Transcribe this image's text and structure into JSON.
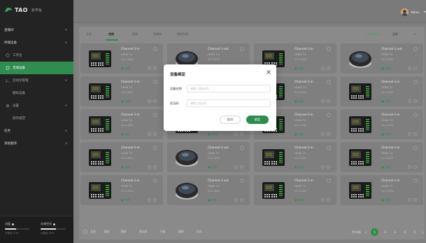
{
  "app": {
    "brand": "TAO",
    "brand_sub": "云平台",
    "accent": "#2e8d4f"
  },
  "header": {
    "username": "Admin"
  },
  "sidebar": {
    "items": [
      {
        "label": "直播间",
        "icon": "chevron-right-icon"
      },
      {
        "label": "终端设备",
        "icon": "chevron-down-icon"
      },
      {
        "label": "工作台",
        "icon": "screen-icon"
      },
      {
        "label": "无线设备",
        "icon": "device-icon"
      },
      {
        "label": "自动化管理",
        "icon": "robot-icon"
      },
      {
        "label": "模拟设备",
        "icon": ""
      },
      {
        "label": "设置",
        "icon": "gear-icon"
      },
      {
        "label": "操作规范",
        "icon": ""
      },
      {
        "label": "任务",
        "icon": "chevron-right-icon"
      },
      {
        "label": "系统翻译",
        "icon": "chevron-right-icon"
      }
    ],
    "footer": [
      {
        "label": "流量",
        "sub": "已使用 5.2G",
        "value": 0.45
      },
      {
        "label": "存储空间",
        "sub": "已使用 32%",
        "value": 0.6
      }
    ]
  },
  "toolbar": {
    "tabs": [
      "全部",
      "在线",
      "离线",
      "待审核",
      "绑定时间"
    ],
    "add_label": "添加设备",
    "filter_label": "全部"
  },
  "cards": [
    {
      "type": "mixer",
      "title": "Channel-1-in",
      "line1": "HDMI TV",
      "line2": "V1.0.002",
      "status": "在线"
    },
    {
      "type": "puck",
      "title": "Channel-1-out",
      "line1": "HDMI TV",
      "line2": "V1.0.002",
      "status": "在线"
    },
    {
      "type": "mixer",
      "title": "Channel-1-in",
      "line1": "HDMI TV",
      "line2": "V1.0.002",
      "status": "在线"
    },
    {
      "type": "puck",
      "title": "Channel-1-out",
      "line1": "HDMI TV",
      "line2": "V1.0.002",
      "status": "在线"
    },
    {
      "type": "mixer",
      "title": "Channel-1-in",
      "line1": "HDMI TV",
      "line2": "V1.0.002",
      "status": "在线"
    },
    {
      "type": "puck",
      "title": "Channel-1-out",
      "line1": "HDMI TV",
      "line2": "V1.0.002",
      "status": "在线"
    },
    {
      "type": "mixer",
      "title": "Channel-1-in",
      "line1": "HDMI TV",
      "line2": "V1.0.002",
      "status": "在线"
    },
    {
      "type": "mixer",
      "title": "Channel-1-in",
      "line1": "HDMI TV",
      "line2": "V1.0.002",
      "status": "在线"
    },
    {
      "type": "mixer",
      "title": "Channel-1-in",
      "line1": "HDMI TV",
      "line2": "V1.0.002",
      "status": "在线"
    },
    {
      "type": "mixer",
      "title": "Channel-1-in",
      "line1": "HDMI TV",
      "line2": "V1.0.002",
      "status": "在线"
    },
    {
      "type": "mixer",
      "title": "Channel-1-in",
      "line1": "HDMI TV",
      "line2": "V1.0.002",
      "status": "在线"
    },
    {
      "type": "mixer",
      "title": "Channel-1-in",
      "line1": "HDMI TV",
      "line2": "V1.0.002",
      "status": "在线"
    },
    {
      "type": "mixer",
      "title": "Channel-1-in",
      "line1": "HDMI TV",
      "line2": "V1.0.002",
      "status": "在线"
    },
    {
      "type": "puck",
      "title": "Channel-1-out",
      "line1": "HDMI TV",
      "line2": "V1.0.002",
      "status": "在线"
    },
    {
      "type": "mixer",
      "title": "Channel-1-in",
      "line1": "HDMI TV",
      "line2": "V1.0.002",
      "status": "在线"
    },
    {
      "type": "mixer",
      "title": "Channel-1-in",
      "line1": "HDMI TV",
      "line2": "V1.0.002",
      "status": "在线"
    },
    {
      "type": "mixer",
      "title": "Channel-1-in",
      "line1": "HDMI TV",
      "line2": "V1.0.002",
      "status": "在线"
    },
    {
      "type": "puck",
      "title": "Channel-1-out",
      "line1": "HDMI TV",
      "line2": "V1.0.002",
      "status": "在线"
    },
    {
      "type": "mixer",
      "title": "Channel-1-in",
      "line1": "HDMI TV",
      "line2": "V1.0.002",
      "status": "在线"
    },
    {
      "type": "mixer",
      "title": "Channel-1-in",
      "line1": "HDMI TV",
      "line2": "V1.0.002",
      "status": "在线"
    }
  ],
  "bottom": {
    "actions": [
      "全选",
      "重启",
      "删除",
      "移动到",
      "升级",
      "解绑",
      "导出"
    ],
    "pager_label": "共50条",
    "pages": [
      "1",
      "2",
      "3",
      "4",
      "5"
    ]
  },
  "modal": {
    "title": "设备绑定",
    "field1_label": "设备名称",
    "field1_placeholder": "请输入设备名称",
    "field2_label": "验证码",
    "field2_placeholder": "请输入验证码",
    "cancel_label": "取消",
    "ok_label": "绑定"
  }
}
